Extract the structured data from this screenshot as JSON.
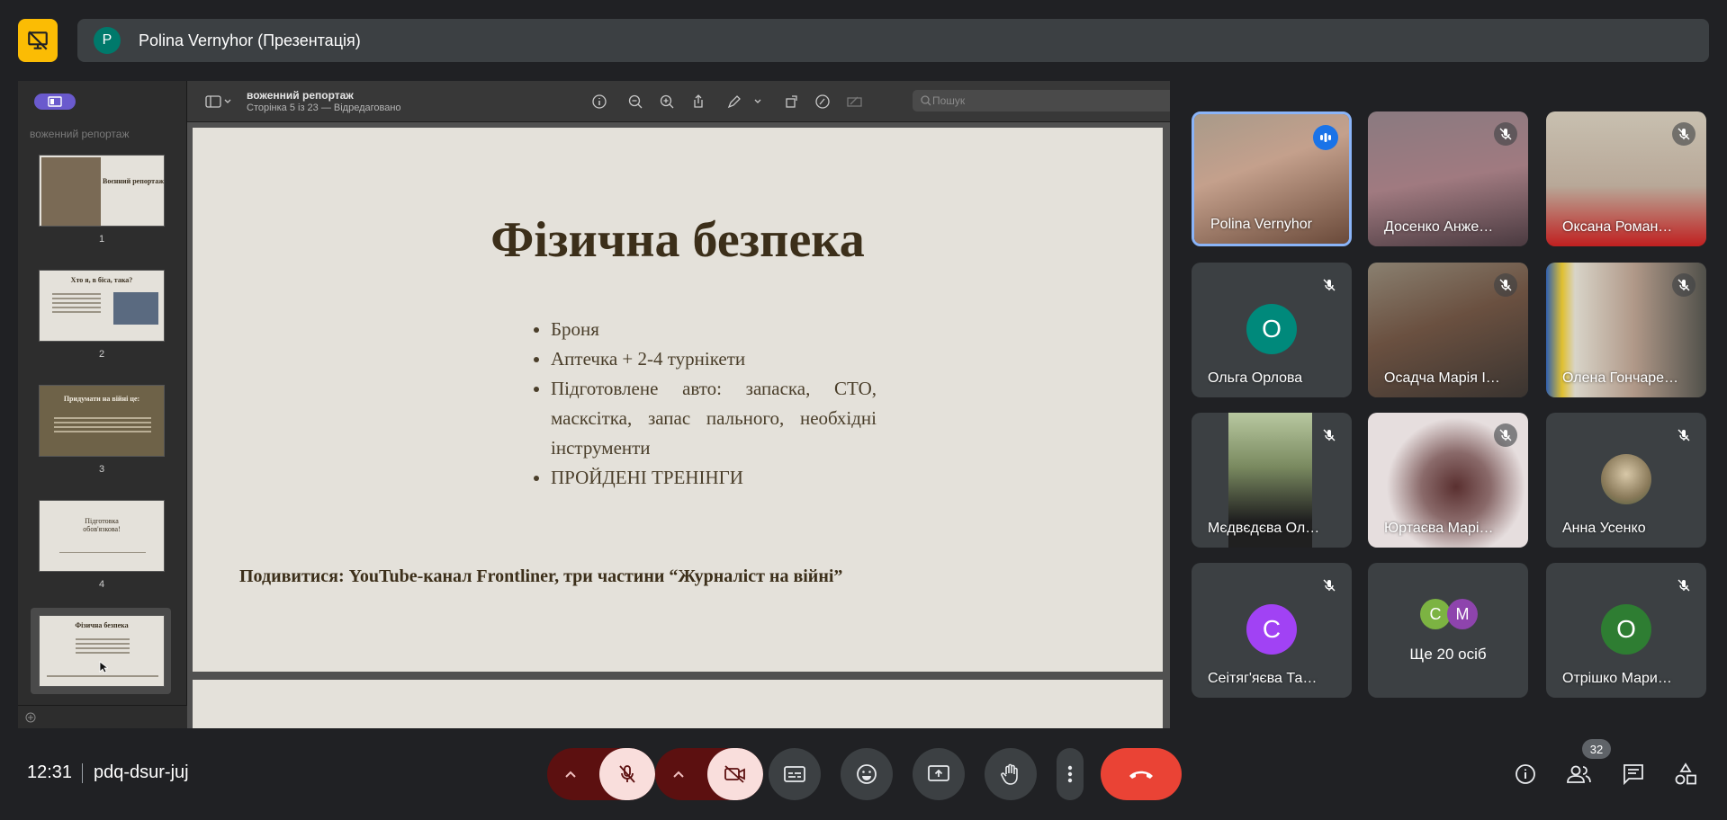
{
  "presenter_bar": {
    "avatar_letter": "P",
    "title": "Polina Vernyhor (Презентація)"
  },
  "presentation": {
    "doc_title": "воженний репортаж",
    "doc_subtitle": "Сторінка 5 із 23 — Відредаговано",
    "sidebar_title": "воженний репортаж",
    "search_placeholder": "Пошук",
    "thumbnails": [
      {
        "num": "1",
        "title": "Воєнний репортаж"
      },
      {
        "num": "2",
        "title": "Хто я, в біса, така?"
      },
      {
        "num": "3",
        "title": "Придумати на війні це:"
      },
      {
        "num": "4",
        "title": "Підготовка обов'язкова!"
      },
      {
        "num": "5",
        "title": "Фізична безпека"
      }
    ],
    "slide": {
      "title": "Фізична безпека",
      "bullets": [
        "Броня",
        "Аптечка + 2-4 турнікети",
        "Підготовлене авто: запаска, СТО, масксітка, запас пального, необхідні інструменти",
        "ПРОЙДЕНІ ТРЕНІНГИ"
      ],
      "footer": "Подивитися: YouTube-канал Frontliner, три частини “Журналіст на війні”"
    }
  },
  "participants": [
    {
      "name": "Polina Vernyhor",
      "state": "speaking",
      "video": true
    },
    {
      "name": "Досенко Анже…",
      "state": "muted",
      "video": true
    },
    {
      "name": "Оксана Роман…",
      "state": "muted",
      "video": true
    },
    {
      "name": "Ольга Орлова",
      "state": "muted",
      "video": false,
      "letter": "О",
      "color": "#00897b"
    },
    {
      "name": "Осадча Марія І…",
      "state": "muted",
      "video": true
    },
    {
      "name": "Олена Гончаре…",
      "state": "muted",
      "video": true
    },
    {
      "name": "Мєдвєдєва Ол…",
      "state": "muted",
      "video": true
    },
    {
      "name": "Юртаєва Марі…",
      "state": "muted",
      "video": true
    },
    {
      "name": "Анна Усенко",
      "state": "muted",
      "video": false
    },
    {
      "name": "Сеітяг'яєва Та…",
      "state": "muted",
      "video": false,
      "letter": "С",
      "color": "#a142f4"
    },
    {
      "name": "Ще 20 осіб",
      "state": "group",
      "letters": [
        "С",
        "М"
      ]
    },
    {
      "name": "Отрішко Мари…",
      "state": "muted",
      "video": false,
      "letter": "О",
      "color": "#2e7d32"
    }
  ],
  "bottom_bar": {
    "time": "12:31",
    "meeting_code": "pdq-dsur-juj",
    "people_count": "32"
  }
}
